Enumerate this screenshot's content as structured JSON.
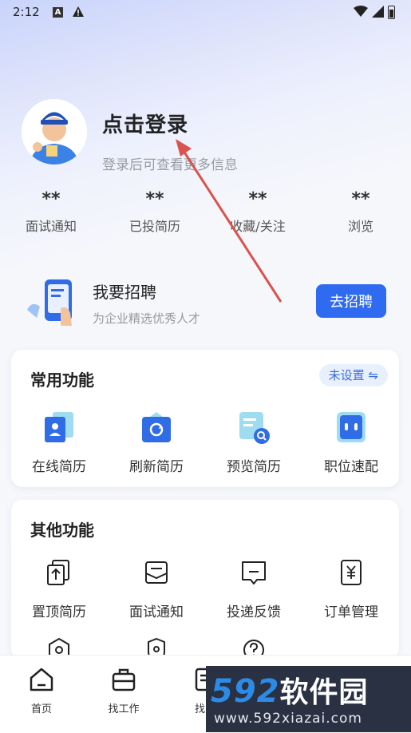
{
  "status_bar": {
    "time": "2:12",
    "a_badge": "A"
  },
  "profile": {
    "title": "点击登录",
    "subtitle": "登录后可查看更多信息"
  },
  "stats": [
    {
      "value": "**",
      "label": "面试通知"
    },
    {
      "value": "**",
      "label": "已投简历"
    },
    {
      "value": "**",
      "label": "收藏/关注"
    },
    {
      "value": "**",
      "label": "浏览"
    }
  ],
  "recruit": {
    "title": "我要招聘",
    "subtitle": "为企业精选优秀人才",
    "button": "去招聘"
  },
  "common": {
    "title": "常用功能",
    "badge": "未设置 ⇋",
    "items": [
      {
        "label": "在线简历",
        "icon": "online-resume-icon"
      },
      {
        "label": "刷新简历",
        "icon": "refresh-resume-icon"
      },
      {
        "label": "预览简历",
        "icon": "preview-resume-icon"
      },
      {
        "label": "职位速配",
        "icon": "job-match-icon"
      }
    ]
  },
  "other": {
    "title": "其他功能",
    "items": [
      {
        "label": "置顶简历",
        "icon": "pin-resume-icon"
      },
      {
        "label": "面试通知",
        "icon": "interview-mail-icon"
      },
      {
        "label": "投递反馈",
        "icon": "feedback-icon"
      },
      {
        "label": "订单管理",
        "icon": "order-icon"
      }
    ]
  },
  "tabbar": [
    {
      "label": "首页",
      "icon": "home-icon"
    },
    {
      "label": "找工作",
      "icon": "briefcase-icon"
    },
    {
      "label": "找人",
      "icon": "find-person-icon"
    }
  ],
  "watermark": {
    "brand_num": "592",
    "brand_cn": "软件园",
    "url": "www.592xiazai.com"
  },
  "colors": {
    "accent": "#2e6bf0",
    "icon_blue": "#2f6ce5",
    "arrow": "#d9534f"
  }
}
